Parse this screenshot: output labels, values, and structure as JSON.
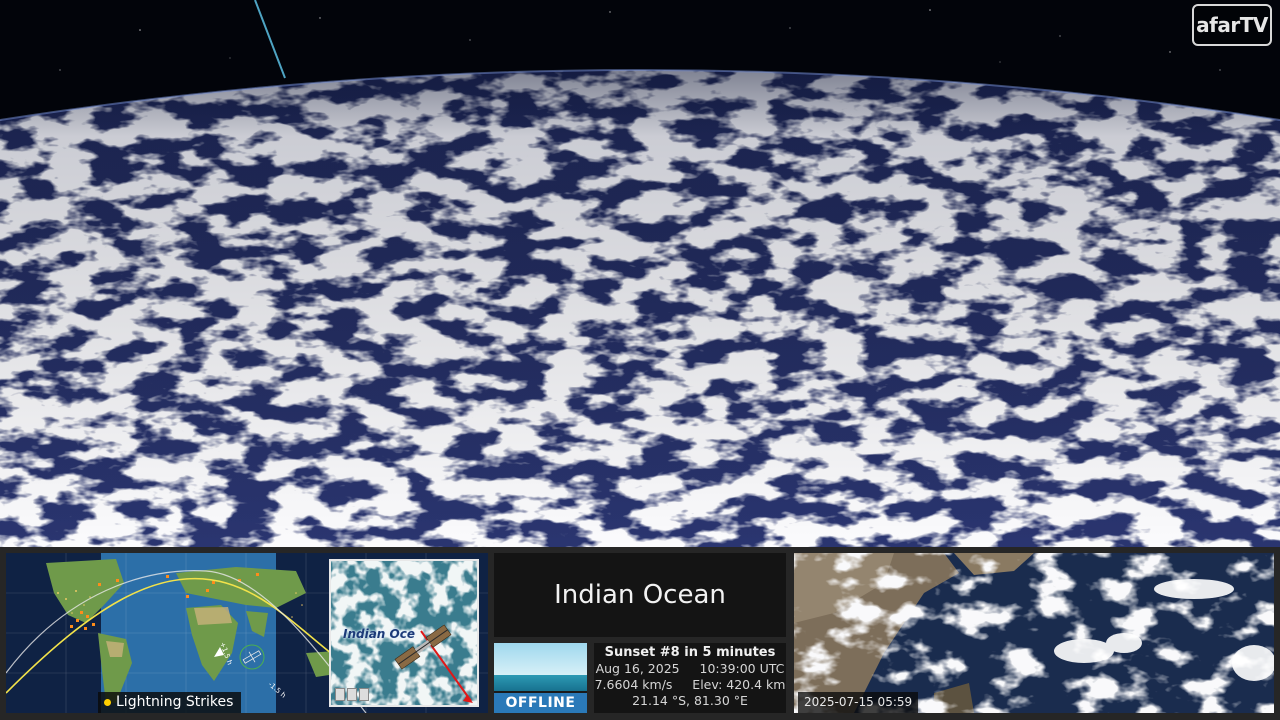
{
  "brand": {
    "logo_text": "afarTV"
  },
  "map": {
    "inset_label": "Indian Oce",
    "lightning_label": "Lightning Strikes",
    "pass_marker_1": "+1.5 h",
    "pass_marker_2": "-1.5 h"
  },
  "location": {
    "name": "Indian Ocean"
  },
  "camera": {
    "status": "OFFLINE"
  },
  "telemetry": {
    "headline": "Sunset #8 in 5 minutes",
    "date": "Aug 16, 2025",
    "time": "10:39:00 UTC",
    "speed": "7.6604 km/s",
    "elevation": "Elev: 420.4 km",
    "coordinates": "21.14 °S, 81.30 °E"
  },
  "satellite_image": {
    "timestamp": "2025-07-15 05:59"
  },
  "colors": {
    "offline_badge": "#2a79b8",
    "orbit_track": "#f2e24a",
    "lightning": "#ff8c1a",
    "panel_bg": "#262626"
  }
}
